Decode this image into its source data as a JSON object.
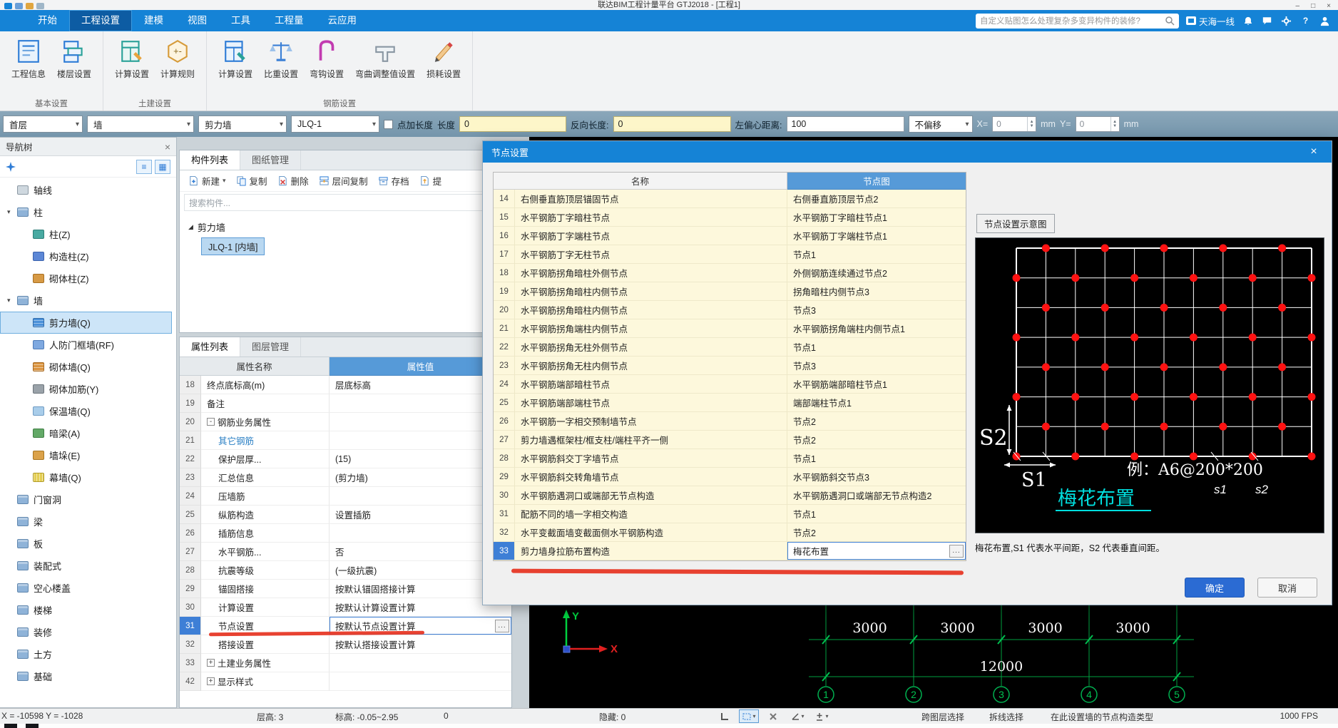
{
  "window": {
    "title": "联达BIM工程计量平台 GTJ2018 - [工程1]",
    "controls": {
      "minimize": "–",
      "maximize": "□",
      "close": "×"
    }
  },
  "ribbon": {
    "tabs": [
      {
        "label": "开始"
      },
      {
        "label": "工程设置",
        "active": true
      },
      {
        "label": "建模"
      },
      {
        "label": "视图"
      },
      {
        "label": "工具"
      },
      {
        "label": "工程量"
      },
      {
        "label": "云应用"
      }
    ],
    "search_placeholder": "自定义贴图怎么处理复杂多变异构件的装修?",
    "user": "天海一线",
    "help": "?",
    "groups": [
      {
        "label": "基本设置",
        "buttons": [
          {
            "label": "工程信息"
          },
          {
            "label": "楼层设置"
          }
        ]
      },
      {
        "label": "土建设置",
        "buttons": [
          {
            "label": "计算设置"
          },
          {
            "label": "计算规则"
          }
        ]
      },
      {
        "label": "钢筋设置",
        "buttons": [
          {
            "label": "计算设置"
          },
          {
            "label": "比重设置"
          },
          {
            "label": "弯钩设置"
          },
          {
            "label": "弯曲调整值设置"
          },
          {
            "label": "损耗设置"
          }
        ]
      }
    ]
  },
  "context_bar": {
    "floor": "首层",
    "category": "墙",
    "type": "剪力墙",
    "component": "JLQ-1",
    "dianjia": "点加长度",
    "length_label": "长度",
    "length_value": "0",
    "reverse_label": "反向长度:",
    "reverse_value": "0",
    "offset_label": "左偏心距离:",
    "offset_value": "100",
    "no_offset": "不偏移",
    "x_label": "X=",
    "x_value": "0",
    "x_unit": "mm",
    "y_label": "Y=",
    "y_value": "0",
    "y_unit": "mm"
  },
  "nav": {
    "title": "导航树",
    "items": [
      {
        "label": "轴线",
        "icon": "axis-folder"
      },
      {
        "label": "柱",
        "icon": "folder",
        "arrow": "▾"
      },
      {
        "label": "柱(Z)",
        "icon": "column-z",
        "child": true
      },
      {
        "label": "构造柱(Z)",
        "icon": "structural-column",
        "child": true
      },
      {
        "label": "砌体柱(Z)",
        "icon": "masonry-column",
        "child": true
      },
      {
        "label": "墙",
        "icon": "folder",
        "arrow": "▾"
      },
      {
        "label": "剪力墙(Q)",
        "icon": "shear-wall",
        "child": true,
        "selected": true
      },
      {
        "label": "人防门框墙(RF)",
        "icon": "door-frame-wall",
        "child": true
      },
      {
        "label": "砌体墙(Q)",
        "icon": "masonry-wall",
        "child": true
      },
      {
        "label": "砌体加筋(Y)",
        "icon": "masonry-rebar",
        "child": true
      },
      {
        "label": "保温墙(Q)",
        "icon": "insulation-wall",
        "child": true
      },
      {
        "label": "暗梁(A)",
        "icon": "hidden-beam",
        "child": true
      },
      {
        "label": "墙垛(E)",
        "icon": "wall-pier",
        "child": true
      },
      {
        "label": "幕墙(Q)",
        "icon": "curtain-wall",
        "child": true
      },
      {
        "label": "门窗洞",
        "icon": "folder"
      },
      {
        "label": "梁",
        "icon": "folder"
      },
      {
        "label": "板",
        "icon": "folder"
      },
      {
        "label": "装配式",
        "icon": "folder"
      },
      {
        "label": "空心楼盖",
        "icon": "folder"
      },
      {
        "label": "楼梯",
        "icon": "folder"
      },
      {
        "label": "装修",
        "icon": "folder"
      },
      {
        "label": "土方",
        "icon": "folder"
      },
      {
        "label": "基础",
        "icon": "folder"
      }
    ]
  },
  "component_panel": {
    "tab_list": "构件列表",
    "tab_drawing": "图纸管理",
    "btn_new": "新建",
    "btn_copy": "复制",
    "btn_delete": "删除",
    "btn_copy_between": "层间复制",
    "btn_archive": "存档",
    "btn_extract": "提",
    "search_placeholder": "搜索构件...",
    "group": "剪力墙",
    "item": "JLQ-1 [内墙]"
  },
  "properties": {
    "tab_props": "属性列表",
    "tab_layers": "图层管理",
    "header_name": "属性名称",
    "header_value": "属性值",
    "rows": [
      {
        "num": "18",
        "name": "终点底标高(m)",
        "value": "层底标高"
      },
      {
        "num": "19",
        "name": "备注",
        "value": ""
      },
      {
        "num": "20",
        "name": "钢筋业务属性",
        "value": "",
        "box": "-"
      },
      {
        "num": "21",
        "name": "其它钢筋",
        "value": "",
        "child": true,
        "link": true
      },
      {
        "num": "22",
        "name": "保护层厚...",
        "value": "(15)",
        "child": true
      },
      {
        "num": "23",
        "name": "汇总信息",
        "value": "(剪力墙)",
        "child": true
      },
      {
        "num": "24",
        "name": "压墙筋",
        "value": "",
        "child": true
      },
      {
        "num": "25",
        "name": "纵筋构造",
        "value": "设置插筋",
        "child": true
      },
      {
        "num": "26",
        "name": "插筋信息",
        "value": "",
        "child": true
      },
      {
        "num": "27",
        "name": "水平钢筋...",
        "value": "否",
        "child": true
      },
      {
        "num": "28",
        "name": "抗震等级",
        "value": "(一级抗震)",
        "child": true
      },
      {
        "num": "29",
        "name": "锚固搭接",
        "value": "按默认锚固搭接计算",
        "child": true
      },
      {
        "num": "30",
        "name": "计算设置",
        "value": "按默认计算设置计算",
        "child": true
      },
      {
        "num": "31",
        "name": "节点设置",
        "value": "按默认节点设置计算",
        "child": true,
        "selected": true,
        "more": true
      },
      {
        "num": "32",
        "name": "搭接设置",
        "value": "按默认搭接设置计算",
        "child": true
      },
      {
        "num": "33",
        "name": "土建业务属性",
        "value": "",
        "box": "+"
      },
      {
        "num": "42",
        "name": "显示样式",
        "value": "",
        "box": "+"
      }
    ]
  },
  "dialog": {
    "title": "节点设置",
    "header_name": "名称",
    "header_diagram": "节点图",
    "rows": [
      {
        "num": "14",
        "name": "右侧垂直筋顶层锚固节点",
        "value": "右侧垂直筋顶层节点2"
      },
      {
        "num": "15",
        "name": "水平钢筋丁字暗柱节点",
        "value": "水平钢筋丁字暗柱节点1"
      },
      {
        "num": "16",
        "name": "水平钢筋丁字端柱节点",
        "value": "水平钢筋丁字端柱节点1"
      },
      {
        "num": "17",
        "name": "水平钢筋丁字无柱节点",
        "value": "节点1"
      },
      {
        "num": "18",
        "name": "水平钢筋拐角暗柱外侧节点",
        "value": "外侧钢筋连续通过节点2"
      },
      {
        "num": "19",
        "name": "水平钢筋拐角暗柱内侧节点",
        "value": "拐角暗柱内侧节点3"
      },
      {
        "num": "20",
        "name": "水平钢筋拐角暗柱内侧节点",
        "value": "节点3"
      },
      {
        "num": "21",
        "name": "水平钢筋拐角端柱内侧节点",
        "value": "水平钢筋拐角端柱内侧节点1"
      },
      {
        "num": "22",
        "name": "水平钢筋拐角无柱外侧节点",
        "value": "节点1"
      },
      {
        "num": "23",
        "name": "水平钢筋拐角无柱内侧节点",
        "value": "节点3"
      },
      {
        "num": "24",
        "name": "水平钢筋端部暗柱节点",
        "value": "水平钢筋端部暗柱节点1"
      },
      {
        "num": "25",
        "name": "水平钢筋端部端柱节点",
        "value": "端部端柱节点1"
      },
      {
        "num": "26",
        "name": "水平钢筋一字相交预制墙节点",
        "value": "节点2"
      },
      {
        "num": "27",
        "name": "剪力墙遇框架柱/框支柱/端柱平齐一侧",
        "value": "节点2"
      },
      {
        "num": "28",
        "name": "水平钢筋斜交丁字墙节点",
        "value": "节点1"
      },
      {
        "num": "29",
        "name": "水平钢筋斜交转角墙节点",
        "value": "水平钢筋斜交节点3"
      },
      {
        "num": "30",
        "name": "水平钢筋遇洞口或端部无节点构造",
        "value": "水平钢筋遇洞口或端部无节点构造2"
      },
      {
        "num": "31",
        "name": "配筋不同的墙一字相交构造",
        "value": "节点1"
      },
      {
        "num": "32",
        "name": "水平变截面墙变截面侧水平钢筋构造",
        "value": "节点2"
      },
      {
        "num": "33",
        "name": "剪力墙身拉筋布置构造",
        "value": "梅花布置",
        "selected": true,
        "more": true
      }
    ],
    "preview": {
      "title": "节点设置示意图",
      "s2_label": "S2",
      "s1_label": "S1",
      "example": "例：A6@200*200",
      "s1_small": "s1",
      "s2_small": "s2",
      "pattern_label": "梅花布置",
      "caption": "梅花布置,S1 代表水平间距，S2 代表垂直间距。",
      "grid": {
        "cols": 10,
        "rows": 7,
        "dot_color": "#ff1212",
        "line_color": "#ffffff"
      }
    },
    "ok_label": "确定",
    "cancel_label": "取消"
  },
  "drawing": {
    "dims": [
      "3000",
      "3000",
      "3000",
      "3000"
    ],
    "total": "12000",
    "axes": [
      "1",
      "2",
      "3",
      "4",
      "5"
    ],
    "x_label": "X",
    "y_label": "Y"
  },
  "status": {
    "coords": "X = -10598 Y = -1028",
    "floor_height": "层高: 3",
    "elevation": "标高: -0.05~2.95",
    "count": "0",
    "hidden": "隐藏: 0",
    "cross_layer": "跨图层选择",
    "polyline_select": "拆线选择",
    "hint": "在此设置墙的节点构造类型",
    "fps": "1000 FPS"
  }
}
